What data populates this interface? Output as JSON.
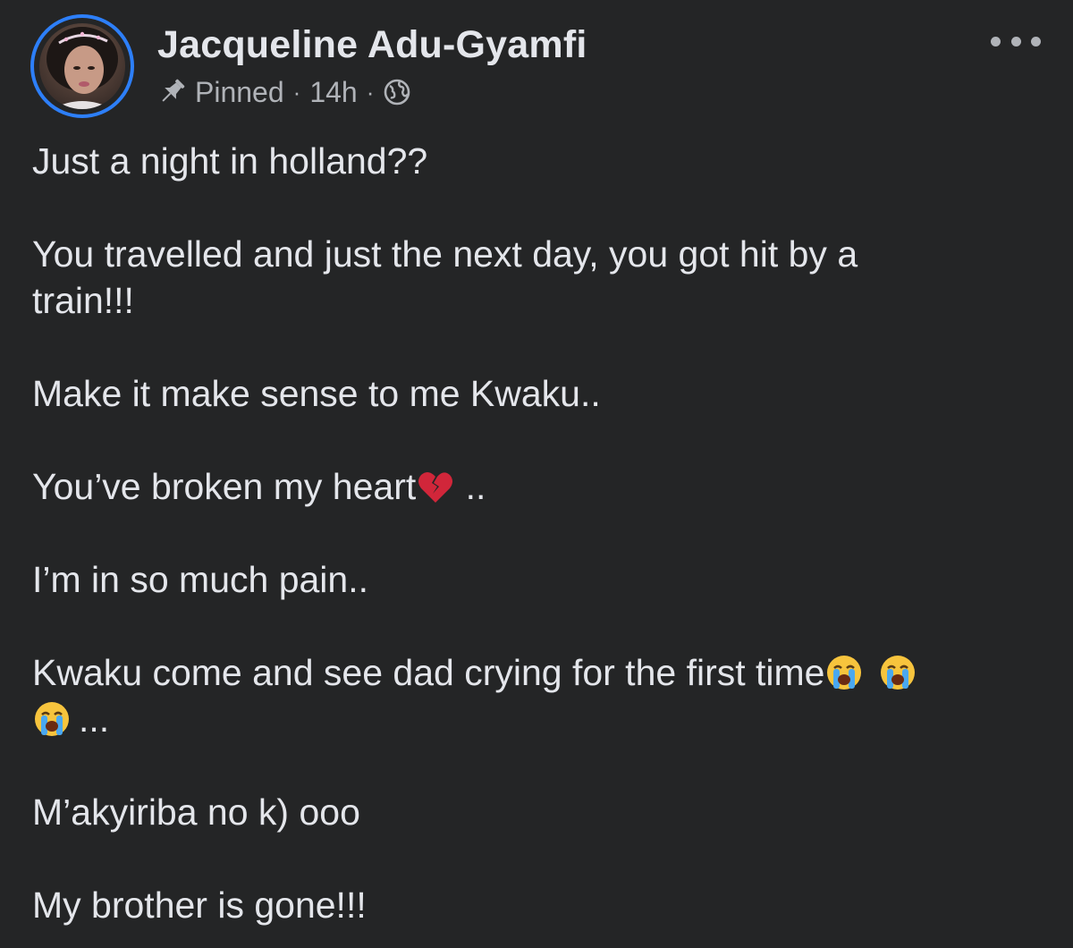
{
  "post": {
    "author": {
      "name": "Jacqueline Adu-Gyamfi",
      "avatar_icon": "profile-photo"
    },
    "meta": {
      "pinned_label": "Pinned",
      "separator": "·",
      "time": "14h",
      "pin_icon": "pin-icon",
      "audience_icon": "globe-icon"
    },
    "more_icon": "ellipsis-icon",
    "paragraphs": {
      "p1": "Just a night in holland??",
      "p2_line1": "You travelled and just the next day, you got hit by a",
      "p2_line2": "train!!!",
      "p3": "Make it make sense to me Kwaku..",
      "p4_text": "You’ve broken my heart",
      "p4_tail": " ..",
      "p5": "I’m in so much pain..",
      "p6_text": "Kwaku come and see dad crying for the first time",
      "p6_tail": "...",
      "p7": "M’akyiriba no k) ooo",
      "p8": "My brother is gone!!!"
    },
    "emojis": {
      "broken_heart": "broken-heart-emoji",
      "crying": "loudly-crying-emoji"
    }
  },
  "colors": {
    "background": "#242526",
    "primary_text": "#e4e6eb",
    "secondary_text": "#b0b3b8",
    "story_ring": "#2d7ff9"
  }
}
